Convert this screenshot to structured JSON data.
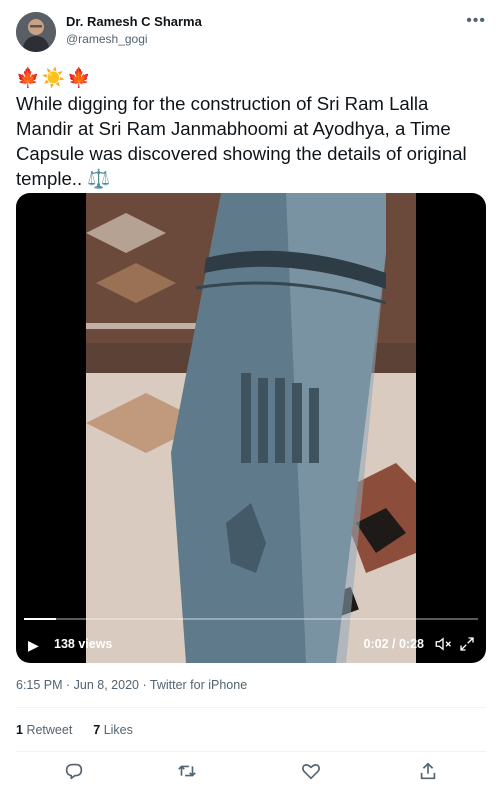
{
  "author": {
    "name": "Dr. Ramesh C Sharma",
    "handle": "@ramesh_gogi"
  },
  "more_icon": "more-horizontal-icon",
  "tweet": {
    "emojis": "🍁☀️🍁",
    "text": "While digging for the construction of Sri Ram Lalla Mandir at Sri Ram Janmabhoomi at Ayodhya, a Time Capsule was discovered showing the details of original temple.. ⚖️"
  },
  "video": {
    "views": "138 views",
    "time": "0:02 / 0:28",
    "progress": 0.07
  },
  "meta": {
    "timestamp": "6:15 PM · Jun 8, 2020 · Twitter for iPhone"
  },
  "stats": {
    "retweet_count": "1",
    "retweet_label": "Retweet",
    "likes_count": "7",
    "likes_label": "Likes"
  },
  "actions": [
    "reply-icon",
    "retweet-icon",
    "like-icon",
    "share-icon"
  ],
  "colors": {
    "text": "#0f1419",
    "secondary": "#536471",
    "divider": "#eff3f4"
  }
}
